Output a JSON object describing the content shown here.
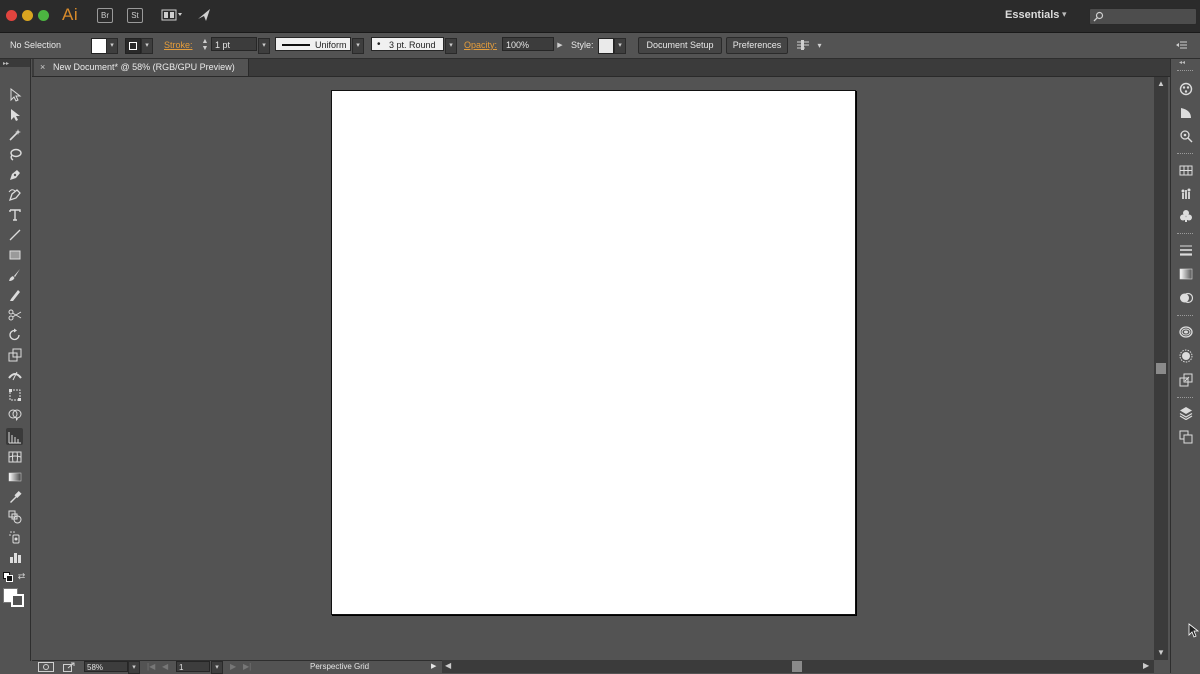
{
  "app": {
    "logo": "Ai",
    "bridge_badge": "Br",
    "stock_badge": "St",
    "workspace": "Essentials"
  },
  "control_bar": {
    "selection": "No Selection",
    "stroke_label": "Stroke:",
    "stroke_weight": "1 pt",
    "stroke_profile": "Uniform",
    "brush": "3 pt. Round",
    "opacity_label": "Opacity:",
    "opacity": "100%",
    "style_label": "Style:",
    "document_setup": "Document Setup",
    "preferences": "Preferences"
  },
  "document": {
    "tab_title": "New Document* @ 58% (RGB/GPU Preview)",
    "close": "×"
  },
  "status_bar": {
    "zoom": "58%",
    "artboard": "1",
    "tool_info": "Perspective Grid"
  },
  "colors": {
    "accent_orange": "#e59d3b",
    "workspace_bg": "#535353",
    "artboard": "#ffffff"
  },
  "tools": [
    "selection-tool",
    "direct-selection-tool",
    "magic-wand-tool",
    "lasso-tool",
    "pen-tool",
    "curvature-tool",
    "type-tool",
    "line-segment-tool",
    "rectangle-tool",
    "paintbrush-tool",
    "pencil-tool",
    "scissors-tool",
    "rotate-tool",
    "scale-tool",
    "width-tool",
    "free-transform-tool",
    "shape-builder-tool",
    "perspective-grid-tool",
    "mesh-tool",
    "gradient-tool",
    "eyedropper-tool",
    "blend-tool",
    "symbol-sprayer-tool",
    "column-graph-tool"
  ]
}
